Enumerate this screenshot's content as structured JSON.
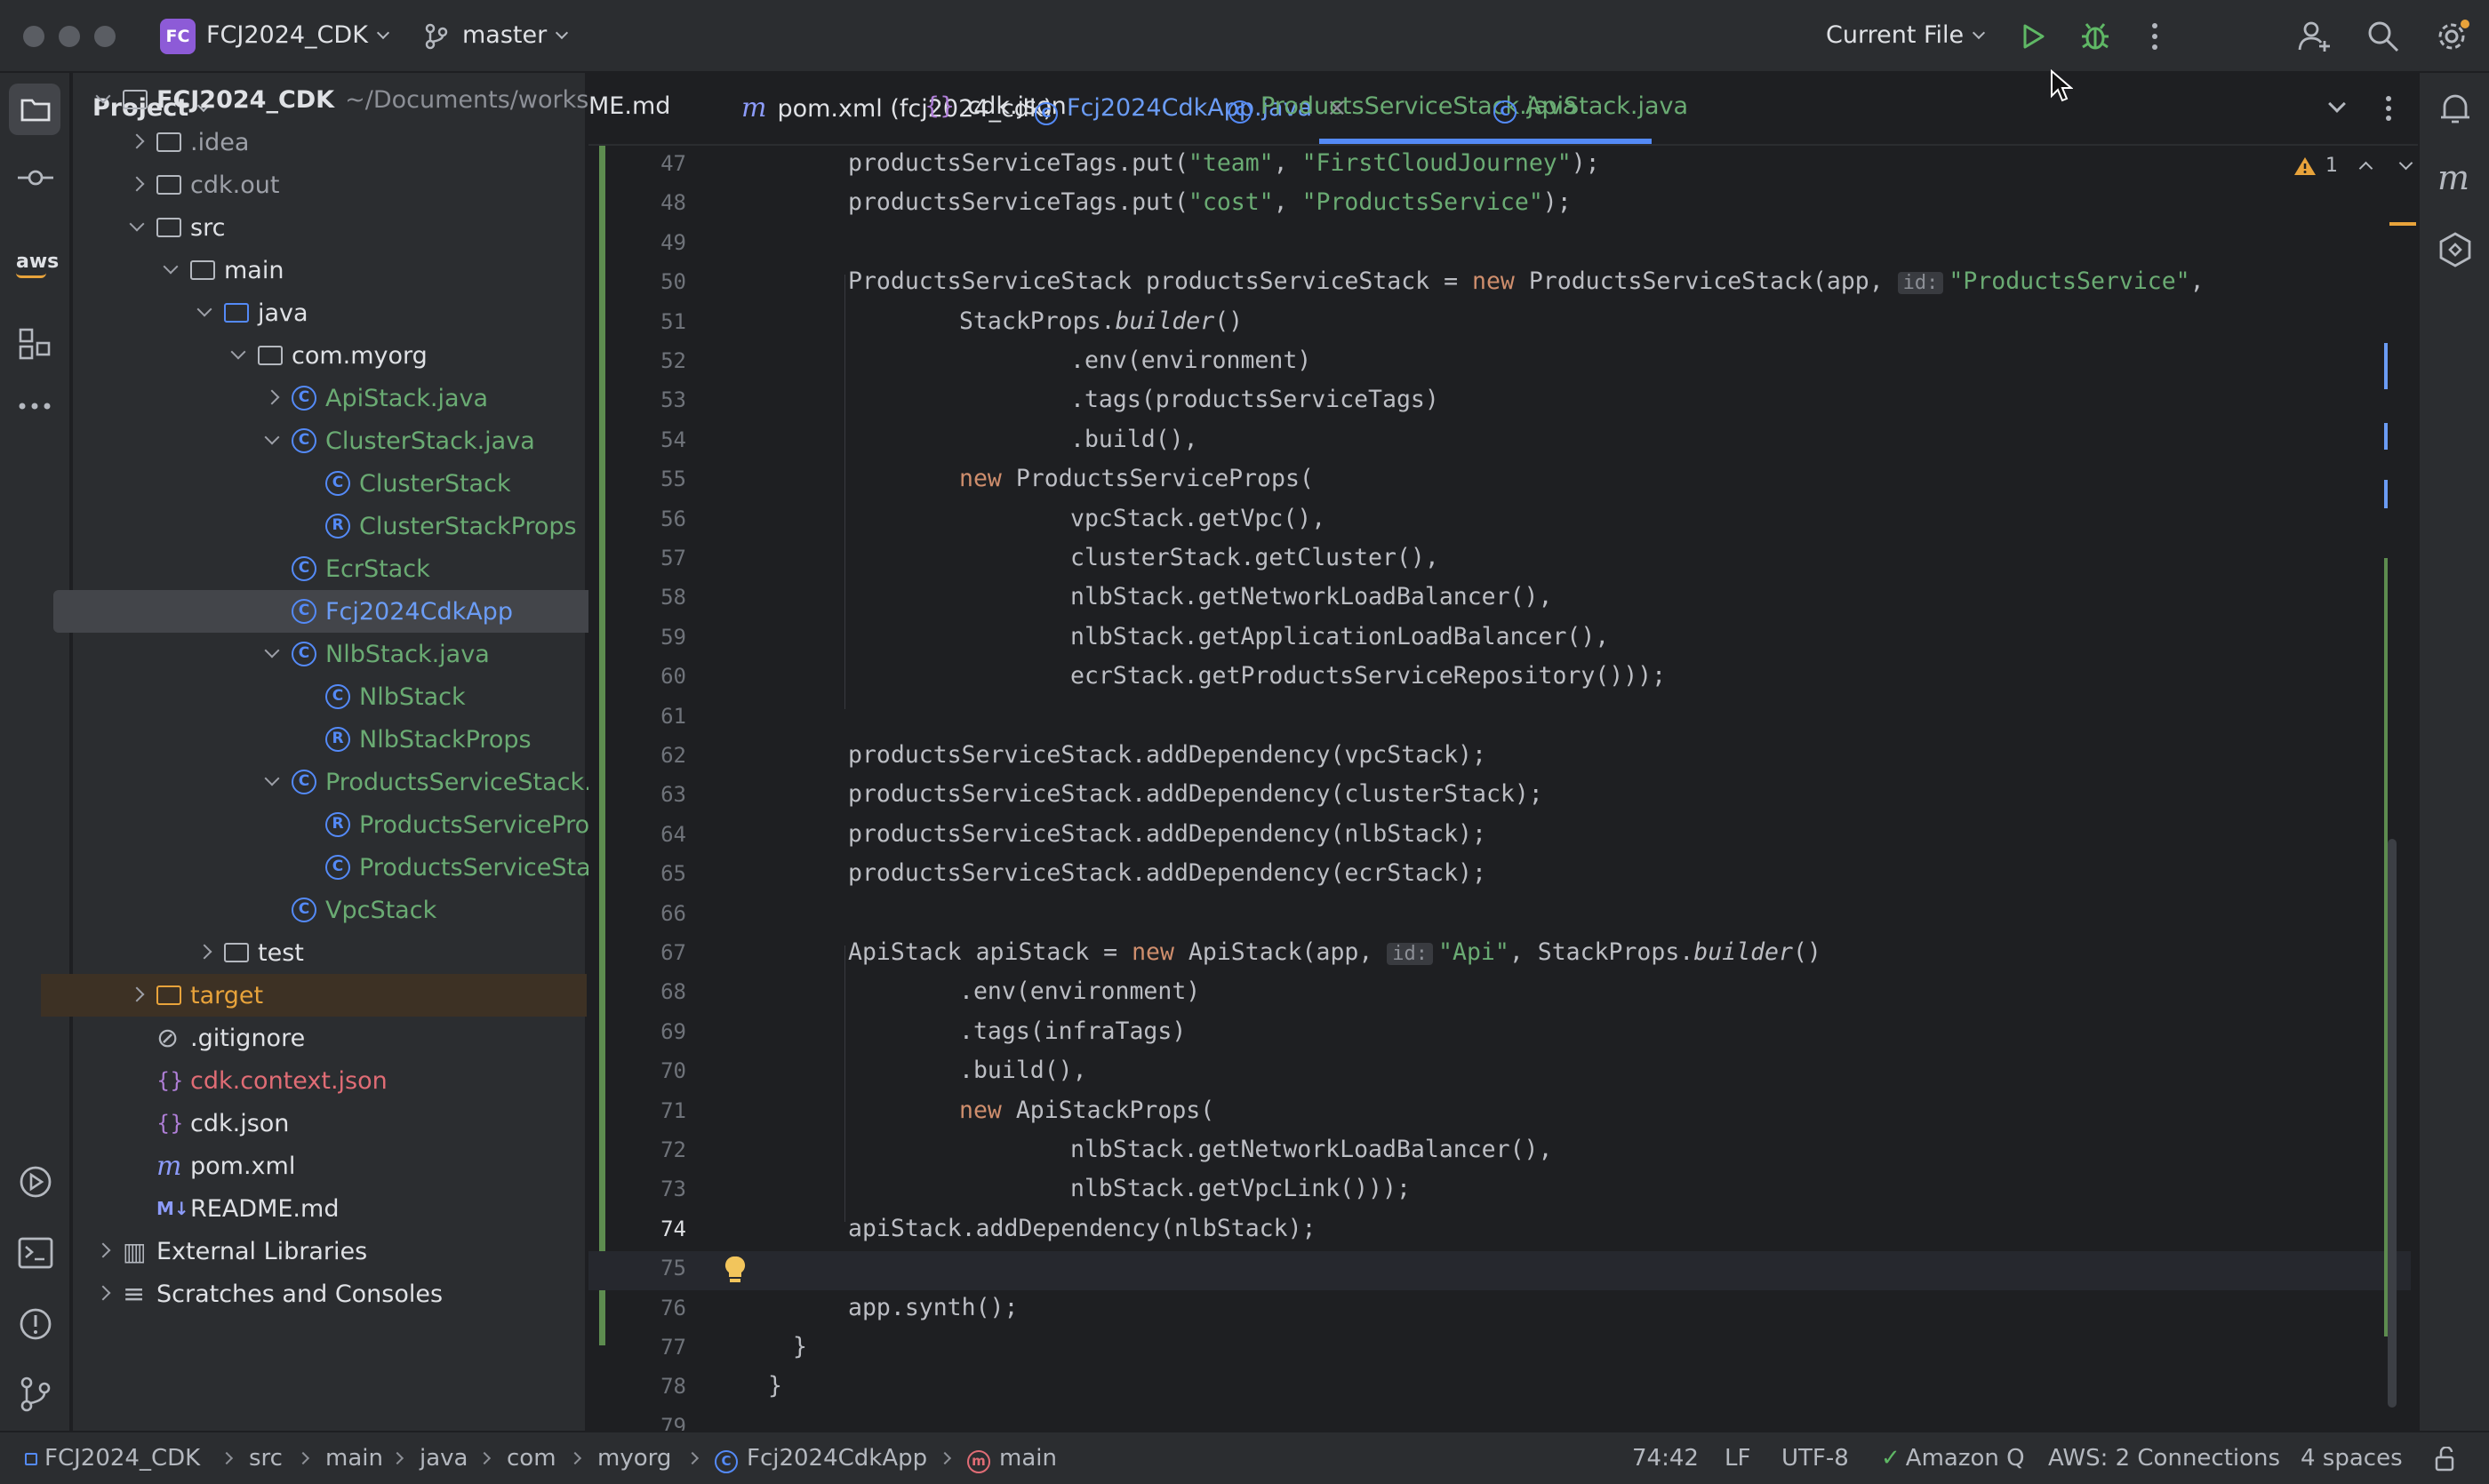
{
  "title_bar": {
    "project_badge": "FC",
    "project_name": "FCJ2024_CDK",
    "branch": "master",
    "run_config": "Current File"
  },
  "project_panel": {
    "header": "Project",
    "tree": [
      {
        "label": "FCJ2024_CDK",
        "suffix": "~/Documents/workshc",
        "kind": "module",
        "depth": 0,
        "expanded": true
      },
      {
        "label": ".idea",
        "kind": "folder",
        "depth": 1,
        "expanded": false,
        "muted": true
      },
      {
        "label": "cdk.out",
        "kind": "folder",
        "depth": 1,
        "expanded": false,
        "muted": true
      },
      {
        "label": "src",
        "kind": "folder",
        "depth": 1,
        "expanded": true
      },
      {
        "label": "main",
        "kind": "folder",
        "depth": 2,
        "expanded": true
      },
      {
        "label": "java",
        "kind": "src-folder",
        "depth": 3,
        "expanded": true
      },
      {
        "label": "com.myorg",
        "kind": "package",
        "depth": 4,
        "expanded": true
      },
      {
        "label": "ApiStack.java",
        "kind": "class-file",
        "depth": 5,
        "expanded": false
      },
      {
        "label": "ClusterStack.java",
        "kind": "class-file",
        "depth": 5,
        "expanded": true
      },
      {
        "label": "ClusterStack",
        "kind": "class",
        "depth": 6
      },
      {
        "label": "ClusterStackProps",
        "kind": "record",
        "depth": 6
      },
      {
        "label": "EcrStack",
        "kind": "class",
        "depth": 5
      },
      {
        "label": "Fcj2024CdkApp",
        "kind": "class",
        "depth": 5,
        "selected": true
      },
      {
        "label": "NlbStack.java",
        "kind": "class-file",
        "depth": 5,
        "expanded": true
      },
      {
        "label": "NlbStack",
        "kind": "class",
        "depth": 6
      },
      {
        "label": "NlbStackProps",
        "kind": "record",
        "depth": 6
      },
      {
        "label": "ProductsServiceStack.j",
        "kind": "class-file",
        "depth": 5,
        "expanded": true
      },
      {
        "label": "ProductsServicePro",
        "kind": "record",
        "depth": 6
      },
      {
        "label": "ProductsServiceSta",
        "kind": "class",
        "depth": 6
      },
      {
        "label": "VpcStack",
        "kind": "class",
        "depth": 5
      },
      {
        "label": "test",
        "kind": "folder",
        "depth": 3,
        "expanded": false
      },
      {
        "label": "target",
        "kind": "folder-excluded",
        "depth": 1,
        "expanded": false
      },
      {
        "label": ".gitignore",
        "kind": "ignore",
        "depth": 1
      },
      {
        "label": "cdk.context.json",
        "kind": "json-red",
        "depth": 1
      },
      {
        "label": "cdk.json",
        "kind": "json",
        "depth": 1
      },
      {
        "label": "pom.xml",
        "kind": "maven",
        "depth": 1
      },
      {
        "label": "README.md",
        "kind": "markdown",
        "depth": 1
      },
      {
        "label": "External Libraries",
        "kind": "libraries",
        "depth": 0,
        "expanded": false
      },
      {
        "label": "Scratches and Consoles",
        "kind": "scratches",
        "depth": 0,
        "expanded": false
      }
    ]
  },
  "tabs": [
    {
      "label": "ME.md",
      "icon": "markdown-icon"
    },
    {
      "label": "pom.xml (fcj2024_cdk)",
      "icon": "maven-icon"
    },
    {
      "label": "cdk.json",
      "icon": "json-icon"
    },
    {
      "label": "Fcj2024CdkApp.java",
      "icon": "class-icon",
      "active": true
    },
    {
      "label": "ProductsServiceStack.java",
      "icon": "class-icon"
    },
    {
      "label": "ApiStack.java",
      "icon": "class-icon"
    }
  ],
  "inspection": {
    "warning_count": "1"
  },
  "code": {
    "current_line": 74,
    "lines": [
      {
        "n": "47",
        "tokens": [
          [
            "i0",
            ""
          ],
          [
            "t",
            "productsServiceTags.put("
          ],
          [
            "s",
            "\"team\""
          ],
          [
            "t",
            ", "
          ],
          [
            "s",
            "\"FirstCloudJourney\""
          ],
          [
            "t",
            ");"
          ]
        ]
      },
      {
        "n": "48",
        "tokens": [
          [
            "i0",
            ""
          ],
          [
            "t",
            "productsServiceTags.put("
          ],
          [
            "s",
            "\"cost\""
          ],
          [
            "t",
            ", "
          ],
          [
            "s",
            "\"ProductsService\""
          ],
          [
            "t",
            ");"
          ]
        ]
      },
      {
        "n": "49",
        "tokens": []
      },
      {
        "n": "50",
        "tokens": [
          [
            "i0",
            ""
          ],
          [
            "t",
            "ProductsServiceStack productsServiceStack = "
          ],
          [
            "k",
            "new"
          ],
          [
            "t",
            " ProductsServiceStack(app, "
          ],
          [
            "h",
            "id:"
          ],
          [
            "s",
            "\"ProductsService\""
          ],
          [
            "t",
            ","
          ]
        ]
      },
      {
        "n": "51",
        "tokens": [
          [
            "i1",
            ""
          ],
          [
            "t",
            "StackProps."
          ],
          [
            "it",
            "builder"
          ],
          [
            "t",
            "()"
          ]
        ]
      },
      {
        "n": "52",
        "tokens": [
          [
            "i2",
            ""
          ],
          [
            "t",
            ".env(environment)"
          ]
        ]
      },
      {
        "n": "53",
        "tokens": [
          [
            "i2",
            ""
          ],
          [
            "t",
            ".tags(productsServiceTags)"
          ]
        ]
      },
      {
        "n": "54",
        "tokens": [
          [
            "i2",
            ""
          ],
          [
            "t",
            ".build(),"
          ]
        ]
      },
      {
        "n": "55",
        "tokens": [
          [
            "i1",
            ""
          ],
          [
            "k",
            "new"
          ],
          [
            "t",
            " ProductsServiceProps("
          ]
        ]
      },
      {
        "n": "56",
        "tokens": [
          [
            "i2",
            ""
          ],
          [
            "t",
            "vpcStack.getVpc(),"
          ]
        ]
      },
      {
        "n": "57",
        "tokens": [
          [
            "i2",
            ""
          ],
          [
            "t",
            "clusterStack.getCluster(),"
          ]
        ]
      },
      {
        "n": "58",
        "tokens": [
          [
            "i2",
            ""
          ],
          [
            "t",
            "nlbStack.getNetworkLoadBalancer(),"
          ]
        ]
      },
      {
        "n": "59",
        "tokens": [
          [
            "i2",
            ""
          ],
          [
            "t",
            "nlbStack.getApplicationLoadBalancer(),"
          ]
        ]
      },
      {
        "n": "60",
        "tokens": [
          [
            "i2",
            ""
          ],
          [
            "t",
            "ecrStack.getProductsServiceRepository()));"
          ]
        ]
      },
      {
        "n": "61",
        "tokens": []
      },
      {
        "n": "62",
        "tokens": [
          [
            "i0",
            ""
          ],
          [
            "t",
            "productsServiceStack.addDependency(vpcStack);"
          ]
        ]
      },
      {
        "n": "63",
        "tokens": [
          [
            "i0",
            ""
          ],
          [
            "t",
            "productsServiceStack.addDependency(clusterStack);"
          ]
        ]
      },
      {
        "n": "64",
        "tokens": [
          [
            "i0",
            ""
          ],
          [
            "t",
            "productsServiceStack.addDependency(nlbStack);"
          ]
        ]
      },
      {
        "n": "65",
        "tokens": [
          [
            "i0",
            ""
          ],
          [
            "t",
            "productsServiceStack.addDependency(ecrStack);"
          ]
        ]
      },
      {
        "n": "66",
        "tokens": []
      },
      {
        "n": "67",
        "tokens": [
          [
            "i0",
            ""
          ],
          [
            "t",
            "ApiStack apiStack = "
          ],
          [
            "k",
            "new"
          ],
          [
            "t",
            " ApiStack(app, "
          ],
          [
            "h",
            "id:"
          ],
          [
            "s",
            "\"Api\""
          ],
          [
            "t",
            ", StackProps."
          ],
          [
            "it",
            "builder"
          ],
          [
            "t",
            "()"
          ]
        ]
      },
      {
        "n": "68",
        "tokens": [
          [
            "i1",
            ""
          ],
          [
            "t",
            ".env(environment)"
          ]
        ]
      },
      {
        "n": "69",
        "tokens": [
          [
            "i1",
            ""
          ],
          [
            "t",
            ".tags(infraTags)"
          ]
        ]
      },
      {
        "n": "70",
        "tokens": [
          [
            "i1",
            ""
          ],
          [
            "t",
            ".build(),"
          ]
        ]
      },
      {
        "n": "71",
        "tokens": [
          [
            "i1",
            ""
          ],
          [
            "k",
            "new"
          ],
          [
            "t",
            " ApiStackProps("
          ]
        ]
      },
      {
        "n": "72",
        "tokens": [
          [
            "i2",
            ""
          ],
          [
            "t",
            "nlbStack.getNetworkLoadBalancer(),"
          ]
        ]
      },
      {
        "n": "73",
        "tokens": [
          [
            "i2",
            ""
          ],
          [
            "t",
            "nlbStack.getVpcLink()));"
          ]
        ]
      },
      {
        "n": "74",
        "tokens": [
          [
            "i0",
            ""
          ],
          [
            "t",
            "apiStack.addDependency(nlbStack);"
          ]
        ]
      },
      {
        "n": "75",
        "tokens": []
      },
      {
        "n": "76",
        "tokens": [
          [
            "i0",
            ""
          ],
          [
            "t",
            "app.synth();"
          ]
        ]
      },
      {
        "n": "77",
        "tokens": [
          [
            "im",
            ""
          ],
          [
            "t",
            "}"
          ]
        ]
      },
      {
        "n": "78",
        "tokens": [
          [
            "t",
            "}"
          ]
        ]
      },
      {
        "n": "79",
        "tokens": []
      }
    ]
  },
  "status_bar": {
    "breadcrumbs": [
      "FCJ2024_CDK",
      "src",
      "main",
      "java",
      "com",
      "myorg",
      "Fcj2024CdkApp",
      "main"
    ],
    "position": "74:42",
    "line_ending": "LF",
    "encoding": "UTF-8",
    "amazon_q": "Amazon Q",
    "aws": "AWS: 2 Connections",
    "indent": "4 spaces"
  },
  "colors": {
    "accent": "#548af7",
    "keyword": "#cf8e6d",
    "string": "#6aab73",
    "class_green": "#6aab73",
    "modified_blue": "#6b9cf5",
    "excluded_bg": "#3d3124"
  }
}
